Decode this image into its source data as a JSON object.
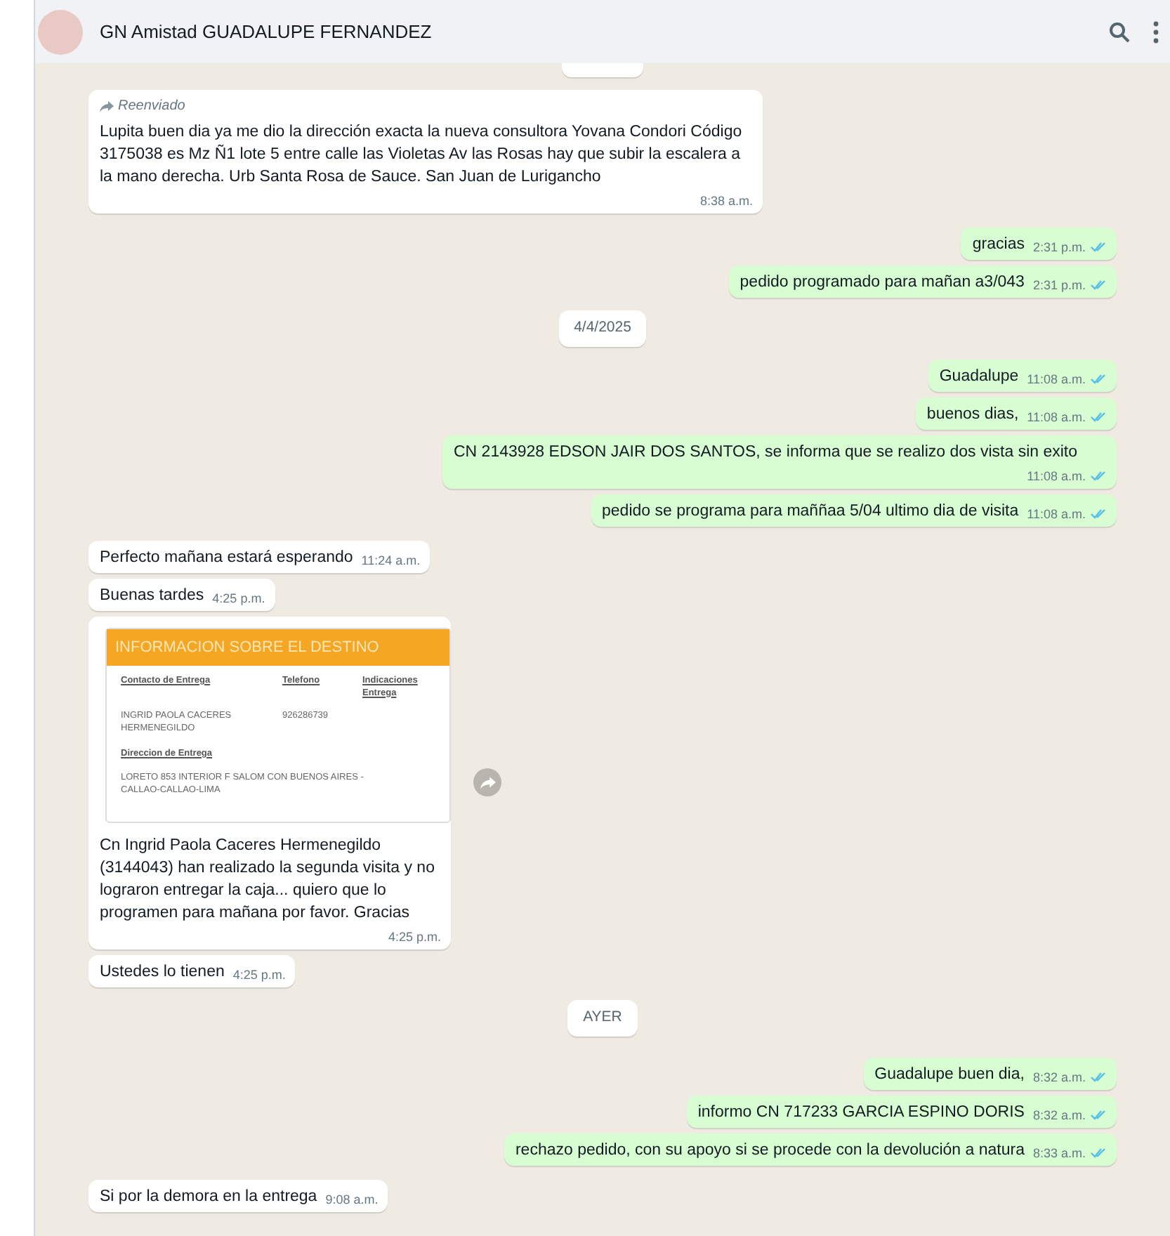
{
  "header": {
    "title": "GN Amistad GUADALUPE FERNANDEZ"
  },
  "messages": [
    {
      "kind": "date_cut"
    },
    {
      "kind": "in",
      "forwarded": "Reenviado",
      "text": "Lupita buen dia ya me dio la dirección exacta la nueva consultora Yovana Condori Código 3175038 es Mz Ñ1 lote 5 entre calle las Violetas Av las Rosas hay que subir la escalera a la mano derecha. Urb Santa Rosa de Sauce. San Juan de Lurigancho",
      "time": "8:38 a.m."
    },
    {
      "kind": "out",
      "text": "gracias",
      "time": "2:31 p.m.",
      "read": true
    },
    {
      "kind": "out",
      "text": "pedido programado para mañan a3/043",
      "time": "2:31 p.m.",
      "read": true
    },
    {
      "kind": "date",
      "text": "4/4/2025"
    },
    {
      "kind": "out",
      "text": "Guadalupe",
      "time": "11:08 a.m.",
      "read": true
    },
    {
      "kind": "out",
      "text": "buenos dias,",
      "time": "11:08 a.m.",
      "read": true
    },
    {
      "kind": "out",
      "text": "CN 2143928 EDSON JAIR DOS SANTOS, se informa que se realizo dos vista sin exito",
      "time": "11:08 a.m.",
      "read": true
    },
    {
      "kind": "out",
      "text": "pedido se programa para maññaa 5/04 ultimo dia de visita",
      "time": "11:08 a.m.",
      "read": true
    },
    {
      "kind": "in",
      "text": "Perfecto mañana estará esperando",
      "time": "11:24 a.m."
    },
    {
      "kind": "in",
      "text": "Buenas tardes",
      "time": "4:25 p.m."
    },
    {
      "kind": "image",
      "doc": {
        "title": "INFORMACION SOBRE EL DESTINO",
        "col_1_head": "Contacto de Entrega",
        "col_2_head": "Telefono",
        "col_3_head": "Indicaciones Entrega",
        "contact": "INGRID PAOLA CACERES HERMENEGILDO",
        "phone": "926286739",
        "address_head": "Direccion de Entrega",
        "address": "LORETO 853 INTERIOR F SALOM CON BUENOS AIRES - CALLAO-CALLAO-LIMA"
      },
      "text": "Cn Ingrid Paola Caceres Hermenegildo (3144043) han realizado la segunda visita y no lograron entregar la caja... quiero que lo programen para mañana por favor. Gracias",
      "time": "4:25 p.m."
    },
    {
      "kind": "in",
      "text": "Ustedes lo tienen",
      "time": "4:25 p.m."
    },
    {
      "kind": "date",
      "text": "AYER"
    },
    {
      "kind": "out",
      "text": "Guadalupe buen dia,",
      "time": "8:32 a.m.",
      "read": true
    },
    {
      "kind": "out",
      "text": "informo CN 717233 GARCIA ESPINO DORIS",
      "time": "8:32 a.m.",
      "read": true
    },
    {
      "kind": "out",
      "text": "rechazo pedido, con su apoyo si se procede con la devolución a natura",
      "time": "8:33 a.m.",
      "read": true
    },
    {
      "kind": "in",
      "text": "Si por la demora en la entrega",
      "time": "9:08 a.m."
    }
  ]
}
